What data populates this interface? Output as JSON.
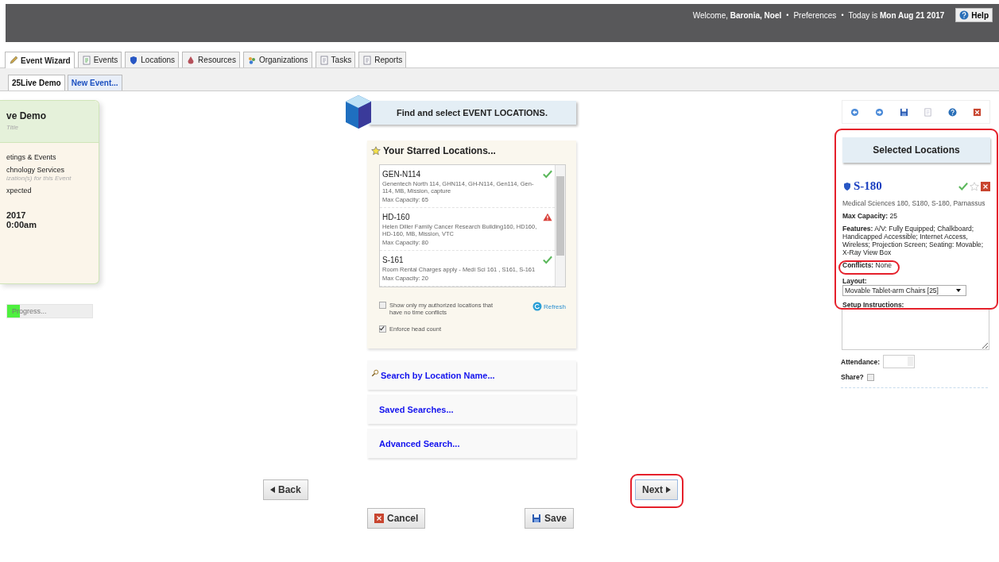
{
  "header": {
    "separators": [
      "•",
      "•"
    ],
    "welcome": "Welcome,",
    "user": "Baronia, Noel",
    "preferences": "Preferences",
    "today_label": "Today is",
    "date": "Mon Aug 21 2017",
    "help": "Help"
  },
  "tabs": [
    {
      "label": "Event Wizard",
      "selected": true
    },
    {
      "label": "Events",
      "selected": false
    },
    {
      "label": "Locations",
      "selected": false
    },
    {
      "label": "Resources",
      "selected": false
    },
    {
      "label": "Organizations",
      "selected": false
    },
    {
      "label": "Tasks",
      "selected": false
    },
    {
      "label": "Reports",
      "selected": false
    }
  ],
  "subtabs": [
    {
      "label": "25Live Demo",
      "selected": true
    },
    {
      "label": "New Event...",
      "selected": false
    }
  ],
  "event_card": {
    "title": "ve Demo",
    "title_hint": "Title",
    "fields": [
      {
        "kind": "value",
        "text": "etings & Events"
      },
      {
        "kind": "value",
        "text": "chnology Services"
      },
      {
        "kind": "hint",
        "text": "ization(s) for this Event"
      },
      {
        "kind": "value",
        "text": "xpected"
      },
      {
        "kind": "date",
        "text": "2017"
      },
      {
        "kind": "date",
        "text": "0:00am"
      }
    ]
  },
  "progress": {
    "label": "Progress...",
    "level": 0.15
  },
  "wizard_step": "Find and select EVENT LOCATIONS.",
  "starred": {
    "title": "Your Starred Locations...",
    "items": [
      {
        "name": "GEN-N114",
        "description": "Genentech North 114, GHN114, GH-N114, Gen114, Gen-114, MB, Mission, capture",
        "capacity": "Max Capacity: 65",
        "kind": "ok"
      },
      {
        "name": "HD-160",
        "description": "Helen Diller Family Cancer Research Building160, HD160, HD-160, MB, Mission, VTC",
        "capacity": "Max Capacity: 80",
        "kind": "warning"
      },
      {
        "name": "S-161",
        "description": "Room Rental Charges apply - Medi Sci 161 , S161, S-161",
        "capacity": "Max Capacity: 20",
        "kind": "ok"
      }
    ],
    "options": [
      {
        "label": "Show only my authorized locations that have no time conflicts",
        "checked": false
      },
      {
        "label": "Enforce head count",
        "checked": true
      }
    ],
    "refresh": "Refresh"
  },
  "searches": [
    {
      "label": "Search by Location Name...",
      "kind": "search"
    },
    {
      "label": "Saved Searches...",
      "kind": "plain"
    },
    {
      "label": "Advanced Search...",
      "kind": "plain"
    }
  ],
  "selected": {
    "title": "Selected Locations",
    "highlighted": true,
    "location": {
      "name": "S-180",
      "description": "Medical Sciences 180, S180, S-180, Parnassus",
      "capacity_label": "Max Capacity:",
      "capacity": "25",
      "features_label": "Features:",
      "features": "A/V: Fully Equipped; Chalkboard; Handicapped Accessible; Internet Access, Wireless; Projection Screen; Seating: Movable; X-Ray View Box",
      "conflicts_label": "Conflicts:",
      "conflicts": "None",
      "conflicts_highlighted": true,
      "layout_label": "Layout:",
      "layout": "Movable Tablet-arm Chairs [25]",
      "setup_label": "Setup Instructions:"
    },
    "attendance_label": "Attendance:",
    "share_label": "Share?",
    "share_checked": false
  },
  "buttons": [
    {
      "label": "Back",
      "kind": "back",
      "highlighted": false
    },
    {
      "label": "Next",
      "kind": "next",
      "highlighted": true
    },
    {
      "label": "Cancel",
      "kind": "cancel",
      "highlighted": false
    },
    {
      "label": "Save",
      "kind": "save",
      "highlighted": false
    }
  ]
}
